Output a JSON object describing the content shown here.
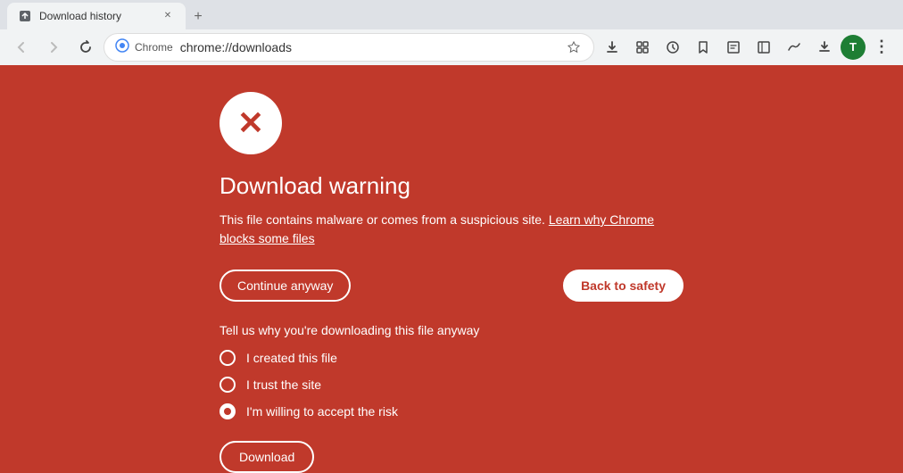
{
  "browser": {
    "tab": {
      "title": "Download history",
      "favicon": "⬇"
    },
    "new_tab_btn": "+",
    "nav": {
      "back_label": "←",
      "forward_label": "→",
      "refresh_label": "↻"
    },
    "address": {
      "chrome_label": "Chrome",
      "url": "chrome://downloads",
      "star_icon": "☆",
      "book_icon": "📖"
    },
    "toolbar_icons": [
      "⊡",
      "⊞",
      "⊟",
      "★",
      "⚙",
      "↓"
    ],
    "profile_label": "T",
    "more_icon": "⋮"
  },
  "page": {
    "icon": "✕",
    "title": "Download warning",
    "description": "This file contains malware or comes from a suspicious site.",
    "learn_more_text": "Learn why Chrome blocks some files",
    "buttons": {
      "continue_anyway": "Continue anyway",
      "back_to_safety": "Back to safety",
      "download": "Download"
    },
    "tell_us_text": "Tell us why you're downloading this file anyway",
    "radio_options": [
      {
        "id": "opt1",
        "label": "I created this file",
        "selected": false
      },
      {
        "id": "opt2",
        "label": "I trust the site",
        "selected": false
      },
      {
        "id": "opt3",
        "label": "I'm willing to accept the risk",
        "selected": true
      }
    ]
  },
  "colors": {
    "bg": "#c0392b",
    "text_white": "#ffffff"
  }
}
